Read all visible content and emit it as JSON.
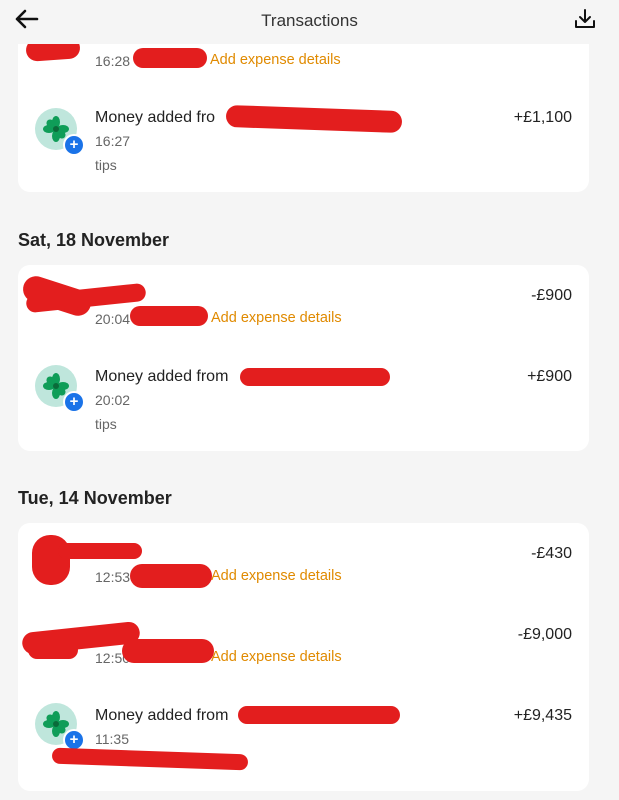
{
  "header": {
    "title": "Transactions"
  },
  "icons": {
    "back": "arrow-left-icon",
    "download": "download-icon",
    "app_logo": "green-leaf-logo",
    "plus_badge": "plus-icon"
  },
  "colors": {
    "accent_link": "#e08a00",
    "badge": "#1a73e8",
    "redaction": "#e31e1e",
    "avatar_bg": "#bfe6dc"
  },
  "groups": [
    {
      "date": "",
      "items": [
        {
          "title": "",
          "time": "16:28",
          "link": "Add expense details",
          "amount": ""
        },
        {
          "title": "Money added fro",
          "time": "16:27",
          "note": "tips",
          "amount": "+£1,100"
        }
      ]
    },
    {
      "date": "Sat, 18 November",
      "items": [
        {
          "title": "",
          "time": "20:04",
          "link": "Add expense details",
          "amount": "-£900"
        },
        {
          "title": "Money added from",
          "time": "20:02",
          "note": "tips",
          "amount": "+£900"
        }
      ]
    },
    {
      "date": "Tue, 14 November",
      "items": [
        {
          "title": "",
          "time": "12:53",
          "link": "Add expense details",
          "amount": "-£430"
        },
        {
          "title": "",
          "time": "12:50",
          "link": "Add expense details",
          "amount": "-£9,000"
        },
        {
          "title": "Money added from",
          "time": "11:35",
          "amount": "+£9,435"
        }
      ]
    }
  ]
}
